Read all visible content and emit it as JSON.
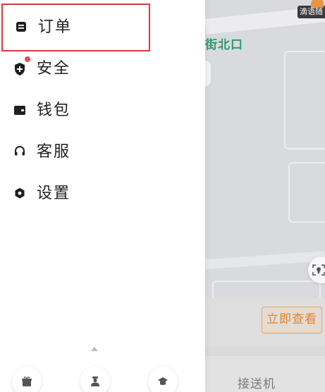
{
  "drawer": {
    "menu": [
      {
        "id": "orders",
        "label": "订单",
        "icon": "receipt-icon",
        "selected": true
      },
      {
        "id": "security",
        "label": "安全",
        "icon": "shield-plus-icon",
        "has_badge": true
      },
      {
        "id": "wallet",
        "label": "钱包",
        "icon": "wallet-icon"
      },
      {
        "id": "service",
        "label": "客服",
        "icon": "headset-icon"
      },
      {
        "id": "settings",
        "label": "设置",
        "icon": "gear-icon"
      }
    ],
    "bottom_buttons": [
      {
        "id": "gift",
        "icon": "gift-box-icon"
      },
      {
        "id": "driver",
        "icon": "driver-person-icon"
      },
      {
        "id": "school",
        "icon": "graduation-cap-icon"
      }
    ]
  },
  "map": {
    "street_label": "街北口",
    "brand_badge": "滴语随",
    "view_now_label": "立即查看",
    "bottom_tab_label": "接送机"
  },
  "colors": {
    "selection_border": "#d33a3a",
    "badge_dot": "#ee4c4c",
    "accent_orange": "#e6832c",
    "street_green": "#2f9b6d"
  }
}
